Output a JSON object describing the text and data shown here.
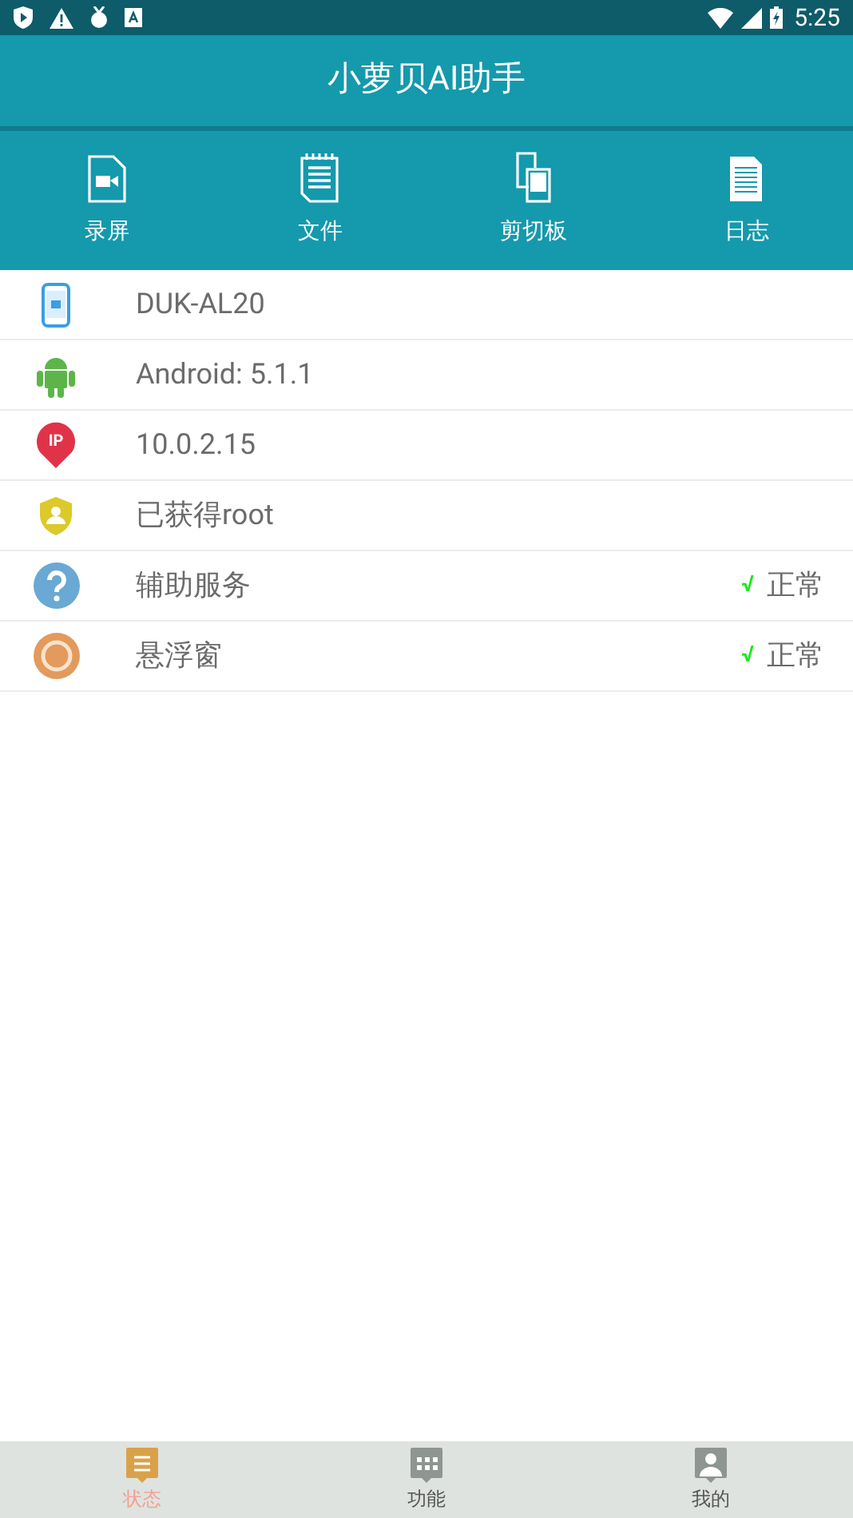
{
  "status_bar": {
    "time": "5:25"
  },
  "app_bar": {
    "title": "小萝贝AI助手"
  },
  "toolbar": [
    {
      "kind": "record",
      "label": "录屏"
    },
    {
      "kind": "file",
      "label": "文件"
    },
    {
      "kind": "clipboard",
      "label": "剪切板"
    },
    {
      "kind": "log",
      "label": "日志"
    }
  ],
  "rows": [
    {
      "kind": "phone",
      "text": "DUK-AL20"
    },
    {
      "kind": "android",
      "text": "Android: 5.1.1"
    },
    {
      "kind": "ip",
      "text": "10.0.2.15",
      "badge": "IP"
    },
    {
      "kind": "root",
      "text": "已获得root"
    },
    {
      "kind": "help",
      "text": "辅助服务",
      "check": "√",
      "status": "正常"
    },
    {
      "kind": "float",
      "text": "悬浮窗",
      "check": "√",
      "status": "正常"
    }
  ],
  "bottom_nav": [
    {
      "kind": "status",
      "label": "状态",
      "selected": true
    },
    {
      "kind": "functions",
      "label": "功能",
      "selected": false
    },
    {
      "kind": "me",
      "label": "我的",
      "selected": false
    }
  ]
}
